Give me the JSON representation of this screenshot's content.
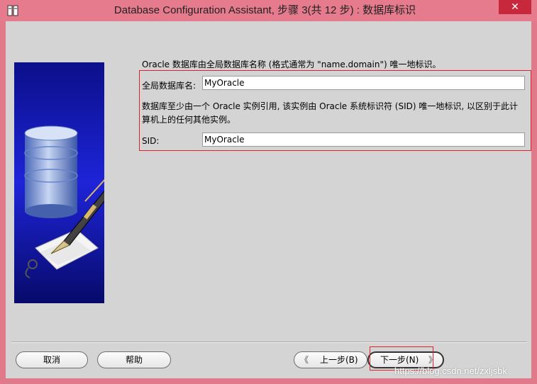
{
  "window": {
    "title": "Database Configuration Assistant, 步骤 3(共 12 步) : 数据库标识",
    "close_glyph": "✕"
  },
  "form": {
    "intro": "Oracle 数据库由全局数据库名称 (格式通常为 \"name.domain\") 唯一地标识。",
    "global_db_label": "全局数据库名:",
    "global_db_value": "MyOracle",
    "sid_desc": "数据库至少由一个 Oracle 实例引用, 该实例由 Oracle 系统标识符 (SID) 唯一地标识, 以区别于此计算机上的任何其他实例。",
    "sid_label": "SID:",
    "sid_value": "MyOracle"
  },
  "buttons": {
    "cancel": "取消",
    "help": "帮助",
    "back": "上一步(B)",
    "next": "下一步(N)",
    "back_arrow": "《",
    "next_arrow": "》"
  },
  "watermark": "https://blog.csdn.net/zxljsbk",
  "colors": {
    "titlebar": "#e57b8c",
    "close": "#c7283c",
    "highlight": "#e0202a",
    "dialog_bg": "#d4d4d4"
  }
}
